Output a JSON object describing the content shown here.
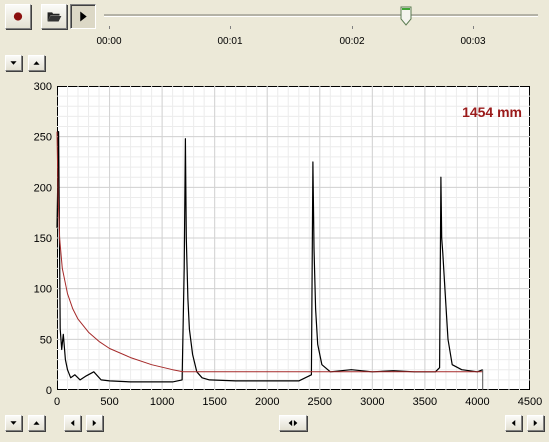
{
  "toolbar": {
    "record_icon": "record-icon",
    "open_icon": "folder-open-icon",
    "play_icon": "play-icon",
    "playback_position": 0.695
  },
  "timeline": {
    "labels": [
      "00:00",
      "00:01",
      "00:02",
      "00:03"
    ]
  },
  "reading": {
    "text": "1454 mm",
    "color": "#9a1a1a"
  },
  "chart_data": {
    "type": "line",
    "title": "",
    "xlabel": "",
    "ylabel": "",
    "xlim": [
      0,
      4500
    ],
    "ylim": [
      0,
      300
    ],
    "xticks": [
      "0",
      "500",
      "1000",
      "1500",
      "2000",
      "2500",
      "3000",
      "3500",
      "4000",
      "4500"
    ],
    "yticks": [
      "0",
      "50",
      "100",
      "150",
      "200",
      "250",
      "300"
    ],
    "grid": true,
    "series": [
      {
        "color": "#000000",
        "x": [
          0,
          15,
          30,
          45,
          60,
          80,
          100,
          130,
          170,
          220,
          280,
          350,
          420,
          500,
          700,
          900,
          1100,
          1190,
          1210,
          1222,
          1230,
          1245,
          1260,
          1290,
          1330,
          1380,
          1450,
          1700,
          2000,
          2300,
          2420,
          2435,
          2445,
          2460,
          2480,
          2520,
          2600,
          2800,
          3000,
          3200,
          3400,
          3600,
          3640,
          3652,
          3660,
          3670,
          3690,
          3720,
          3760,
          3850,
          4000,
          4050
        ],
        "y": [
          160,
          255,
          60,
          40,
          55,
          30,
          20,
          12,
          15,
          10,
          14,
          18,
          10,
          9,
          8,
          8,
          8,
          10,
          120,
          248,
          150,
          90,
          60,
          35,
          18,
          12,
          10,
          9,
          9,
          9,
          15,
          225,
          140,
          80,
          45,
          25,
          18,
          20,
          18,
          19,
          18,
          18,
          22,
          210,
          150,
          135,
          100,
          50,
          25,
          20,
          18,
          20
        ]
      },
      {
        "color": "#a52a2a",
        "x": [
          0,
          10,
          25,
          50,
          100,
          150,
          200,
          300,
          400,
          500,
          700,
          900,
          1100,
          1200,
          1500,
          2000,
          2500,
          3000,
          3500,
          4000,
          4050
        ],
        "y": [
          255,
          190,
          150,
          120,
          95,
          80,
          70,
          57,
          48,
          41,
          32,
          25,
          20,
          18,
          18,
          18,
          18,
          18,
          18,
          18,
          18
        ]
      }
    ]
  }
}
